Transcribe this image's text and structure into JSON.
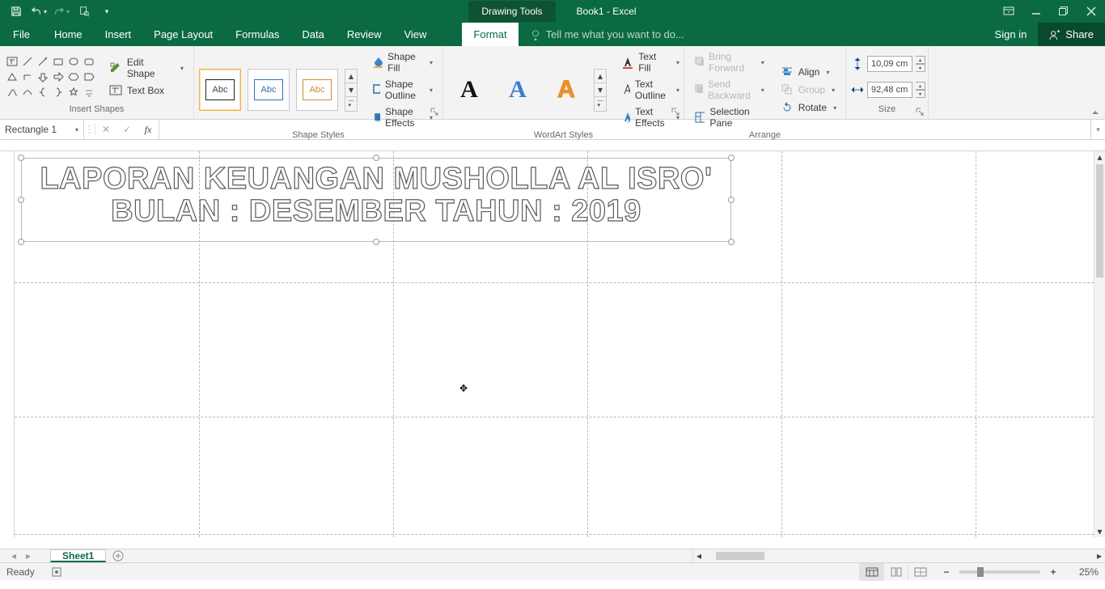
{
  "titlebar": {
    "drawing_tools": "Drawing Tools",
    "document_title": "Book1 - Excel"
  },
  "tabs": {
    "file": "File",
    "home": "Home",
    "insert": "Insert",
    "page_layout": "Page Layout",
    "formulas": "Formulas",
    "data": "Data",
    "review": "Review",
    "view": "View",
    "format": "Format",
    "tell_me": "Tell me what you want to do...",
    "sign_in": "Sign in",
    "share": "Share"
  },
  "ribbon": {
    "insert_shapes": {
      "label": "Insert Shapes",
      "edit_shape": "Edit Shape",
      "text_box": "Text Box"
    },
    "shape_styles": {
      "label": "Shape Styles",
      "thumb_text": "Abc",
      "shape_fill": "Shape Fill",
      "shape_outline": "Shape Outline",
      "shape_effects": "Shape Effects"
    },
    "wordart_styles": {
      "label": "WordArt Styles",
      "glyph": "A",
      "text_fill": "Text Fill",
      "text_outline": "Text Outline",
      "text_effects": "Text Effects"
    },
    "arrange": {
      "label": "Arrange",
      "bring_forward": "Bring Forward",
      "send_backward": "Send Backward",
      "selection_pane": "Selection Pane",
      "align": "Align",
      "group": "Group",
      "rotate": "Rotate"
    },
    "size": {
      "label": "Size",
      "height": "10,09 cm",
      "width": "92,48 cm"
    }
  },
  "namebox": {
    "value": "Rectangle 1"
  },
  "formula": {
    "value": ""
  },
  "shape_text": {
    "line1": "LAPORAN KEUANGAN MUSHOLLA AL ISRO'",
    "line2": "BULAN : DESEMBER TAHUN : 2019"
  },
  "sheet": {
    "tab1": "Sheet1"
  },
  "status": {
    "ready": "Ready",
    "zoom": "25%"
  }
}
